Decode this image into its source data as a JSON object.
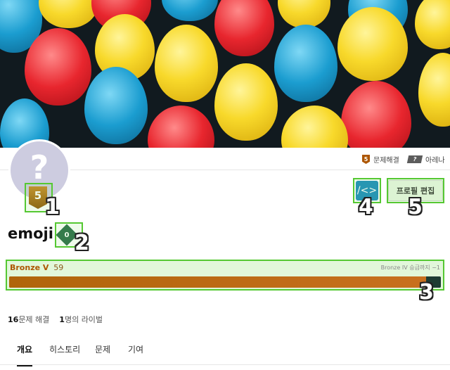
{
  "header": {
    "banner": "balloons-banner"
  },
  "tier_strip": {
    "solved_tier": "5",
    "solved_label": "문제해결",
    "arena_tier": "?",
    "arena_label": "아레나"
  },
  "profile": {
    "avatar_glyph": "?",
    "tier_badge": "5",
    "username": "emoji",
    "class_badge": "0",
    "code_button_label": "/<>",
    "edit_button_label": "프로필 편집"
  },
  "rating": {
    "tier_name": "Bronze V",
    "value": "59",
    "next_label": "Bronze IV 승급까지 −1",
    "progress": 0.966
  },
  "stats": {
    "solved_count": "16",
    "solved_label": "문제 해결",
    "rival_count": "1",
    "rival_label": "명의 라이벌"
  },
  "tabs": [
    "개요",
    "히스토리",
    "문제",
    "기여"
  ],
  "callouts": [
    "1",
    "2",
    "3",
    "4",
    "5"
  ],
  "colors": {
    "bronze": "#ad5600",
    "highlight": "#55c832",
    "code_btn": "#1d8dbf"
  }
}
